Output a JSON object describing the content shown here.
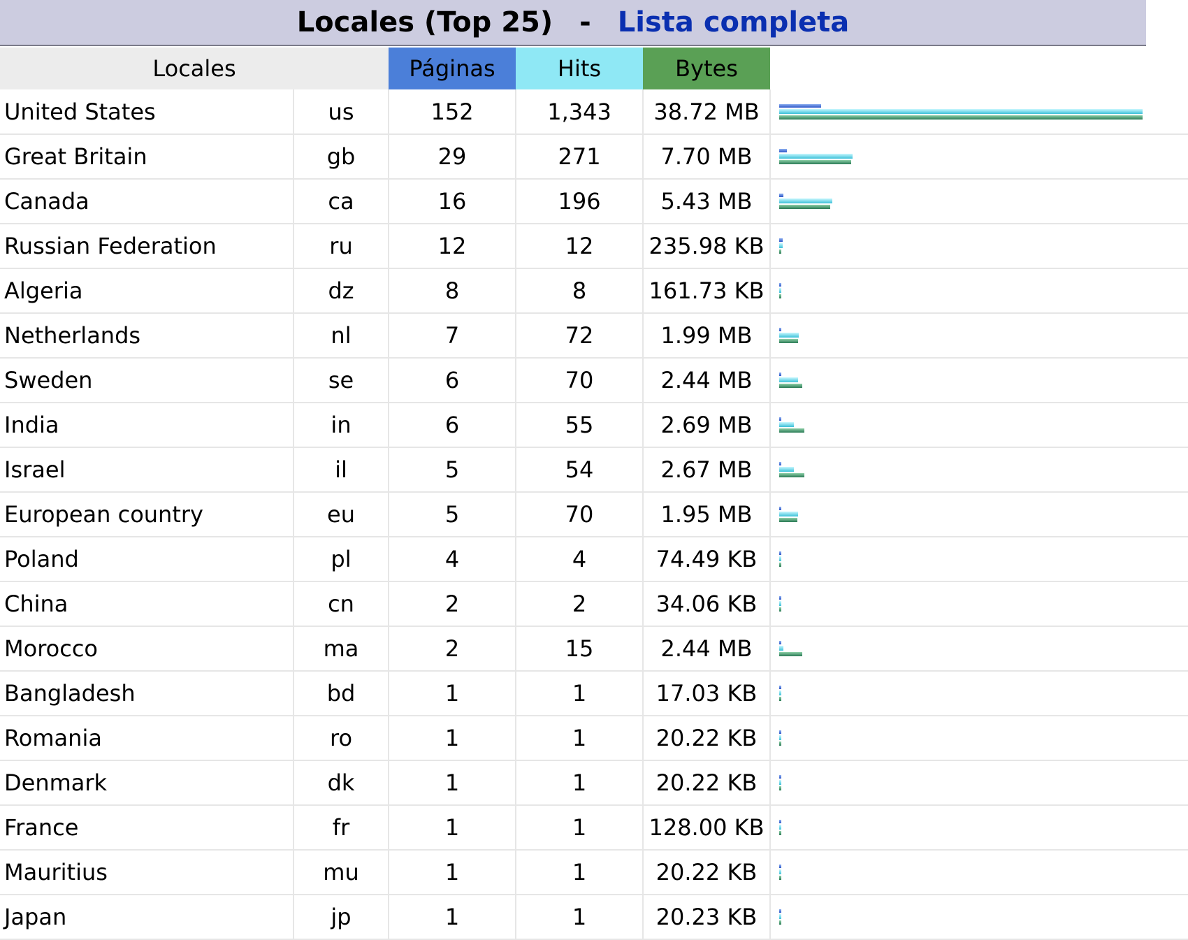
{
  "header": {
    "title": "Locales (Top 25)",
    "separator": "-",
    "full_list_link": "Lista completa"
  },
  "columns": {
    "locales": "Locales",
    "pages": "Páginas",
    "hits": "Hits",
    "bytes": "Bytes"
  },
  "colors": {
    "pages": "#4b7fd9",
    "hits": "#8fe8f5",
    "bytes": "#5aa055",
    "title_bg": "#cccce0",
    "link": "#0a2fb0"
  },
  "rows": [
    {
      "name": "United States",
      "code": "us",
      "pages": "152",
      "hits": "1,343",
      "bytes": "38.72 MB",
      "bar_pages": 0.115,
      "bar_hits": 1.0,
      "bar_bytes": 1.0
    },
    {
      "name": "Great Britain",
      "code": "gb",
      "pages": "29",
      "hits": "271",
      "bytes": "7.70 MB",
      "bar_pages": 0.022,
      "bar_hits": 0.202,
      "bar_bytes": 0.199
    },
    {
      "name": "Canada",
      "code": "ca",
      "pages": "16",
      "hits": "196",
      "bytes": "5.43 MB",
      "bar_pages": 0.012,
      "bar_hits": 0.146,
      "bar_bytes": 0.14
    },
    {
      "name": "Russian Federation",
      "code": "ru",
      "pages": "12",
      "hits": "12",
      "bytes": "235.98 KB",
      "bar_pages": 0.009,
      "bar_hits": 0.009,
      "bar_bytes": 0.006
    },
    {
      "name": "Algeria",
      "code": "dz",
      "pages": "8",
      "hits": "8",
      "bytes": "161.73 KB",
      "bar_pages": 0.006,
      "bar_hits": 0.006,
      "bar_bytes": 0.004
    },
    {
      "name": "Netherlands",
      "code": "nl",
      "pages": "7",
      "hits": "72",
      "bytes": "1.99 MB",
      "bar_pages": 0.005,
      "bar_hits": 0.054,
      "bar_bytes": 0.051
    },
    {
      "name": "Sweden",
      "code": "se",
      "pages": "6",
      "hits": "70",
      "bytes": "2.44 MB",
      "bar_pages": 0.005,
      "bar_hits": 0.052,
      "bar_bytes": 0.063
    },
    {
      "name": "India",
      "code": "in",
      "pages": "6",
      "hits": "55",
      "bytes": "2.69 MB",
      "bar_pages": 0.005,
      "bar_hits": 0.041,
      "bar_bytes": 0.069
    },
    {
      "name": "Israel",
      "code": "il",
      "pages": "5",
      "hits": "54",
      "bytes": "2.67 MB",
      "bar_pages": 0.004,
      "bar_hits": 0.04,
      "bar_bytes": 0.069
    },
    {
      "name": "European country",
      "code": "eu",
      "pages": "5",
      "hits": "70",
      "bytes": "1.95 MB",
      "bar_pages": 0.004,
      "bar_hits": 0.052,
      "bar_bytes": 0.05
    },
    {
      "name": "Poland",
      "code": "pl",
      "pages": "4",
      "hits": "4",
      "bytes": "74.49 KB",
      "bar_pages": 0.003,
      "bar_hits": 0.003,
      "bar_bytes": 0.002
    },
    {
      "name": "China",
      "code": "cn",
      "pages": "2",
      "hits": "2",
      "bytes": "34.06 KB",
      "bar_pages": 0.002,
      "bar_hits": 0.002,
      "bar_bytes": 0.001
    },
    {
      "name": "Morocco",
      "code": "ma",
      "pages": "2",
      "hits": "15",
      "bytes": "2.44 MB",
      "bar_pages": 0.002,
      "bar_hits": 0.011,
      "bar_bytes": 0.063
    },
    {
      "name": "Bangladesh",
      "code": "bd",
      "pages": "1",
      "hits": "1",
      "bytes": "17.03 KB",
      "bar_pages": 0.001,
      "bar_hits": 0.001,
      "bar_bytes": 0.001
    },
    {
      "name": "Romania",
      "code": "ro",
      "pages": "1",
      "hits": "1",
      "bytes": "20.22 KB",
      "bar_pages": 0.001,
      "bar_hits": 0.001,
      "bar_bytes": 0.001
    },
    {
      "name": "Denmark",
      "code": "dk",
      "pages": "1",
      "hits": "1",
      "bytes": "20.22 KB",
      "bar_pages": 0.001,
      "bar_hits": 0.001,
      "bar_bytes": 0.001
    },
    {
      "name": "France",
      "code": "fr",
      "pages": "1",
      "hits": "1",
      "bytes": "128.00 KB",
      "bar_pages": 0.001,
      "bar_hits": 0.001,
      "bar_bytes": 0.003
    },
    {
      "name": "Mauritius",
      "code": "mu",
      "pages": "1",
      "hits": "1",
      "bytes": "20.22 KB",
      "bar_pages": 0.001,
      "bar_hits": 0.001,
      "bar_bytes": 0.001
    },
    {
      "name": "Japan",
      "code": "jp",
      "pages": "1",
      "hits": "1",
      "bytes": "20.23 KB",
      "bar_pages": 0.001,
      "bar_hits": 0.001,
      "bar_bytes": 0.001
    }
  ]
}
